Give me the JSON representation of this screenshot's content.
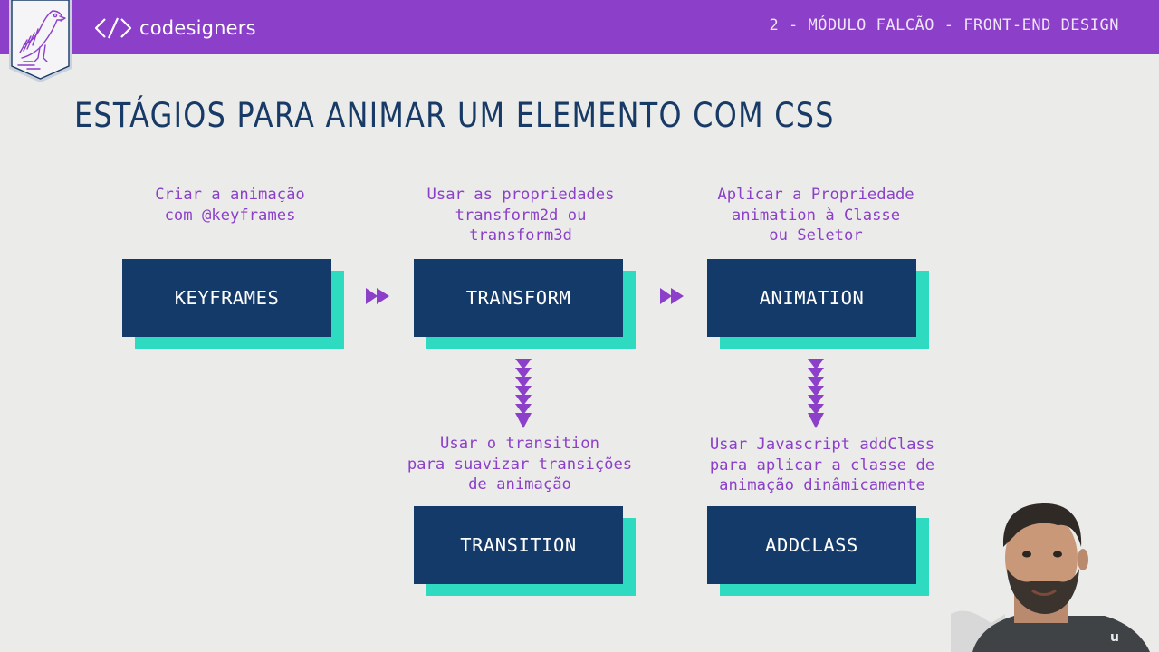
{
  "header": {
    "brand_name": "codesigners",
    "module": "2 - MÓDULO FALCÃO - FRONT-END DESIGN"
  },
  "slide": {
    "title": "ESTÁGIOS PARA ANIMAR UM ELEMENTO COM CSS"
  },
  "stages": {
    "keyframes": {
      "label": "KEYFRAMES",
      "description": "Criar a animação\ncom @keyframes"
    },
    "transform": {
      "label": "TRANSFORM",
      "description": "Usar as propriedades\ntransform2d ou\ntransform3d"
    },
    "animation": {
      "label": "ANIMATION",
      "description": "Aplicar a Propriedade\nanimation à Classe\nou Seletor"
    },
    "transition": {
      "label": "TRANSITION",
      "description": "Usar o transition\npara suavizar transições\nde animação"
    },
    "addclass": {
      "label": "ADDCLASS",
      "description": "Usar Javascript addClass\npara aplicar a classe de\nanimação dinâmicamente"
    }
  },
  "colors": {
    "header_bg": "#8c3fc9",
    "accent_purple": "#8c3fc9",
    "box_navy": "#143a6a",
    "box_shadow_teal": "#2edbc1",
    "title_navy": "#173a66",
    "background": "#ebebea"
  },
  "icons": {
    "logo": "falcon-badge-icon",
    "brand": "code-tag-icon",
    "flow_right": "double-chevron-right-icon",
    "flow_down": "chevron-stack-down-icon"
  }
}
